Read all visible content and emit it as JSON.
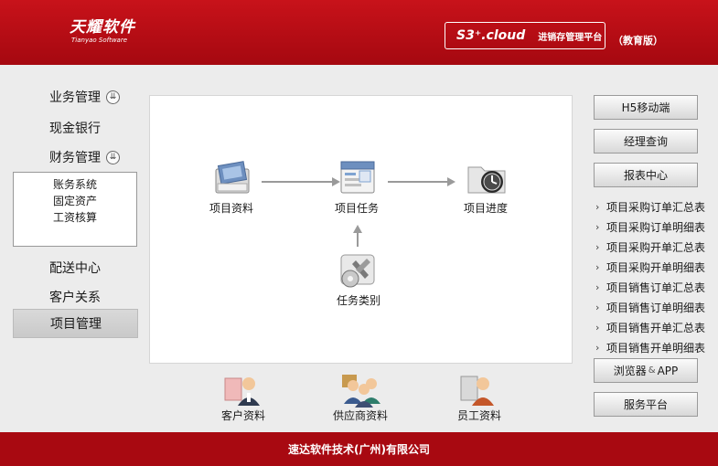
{
  "header": {
    "logo_cn": "天耀软件",
    "logo_en": "Tianyao Software",
    "product_name": "S3⁺.cloud",
    "product_desc": "进销存管理平台",
    "edition": "（教育版）"
  },
  "nav": {
    "business": "业务管理",
    "cash": "现金银行",
    "finance": "财务管理",
    "finance_sub": [
      "账务系统",
      "固定资产",
      "工资核算"
    ],
    "delivery": "配送中心",
    "customer": "客户关系",
    "project": "项目管理",
    "toggle_icon": "double-chevron-down"
  },
  "flow": {
    "project_data": "项目资料",
    "project_task": "项目任务",
    "project_progress": "项目进度",
    "task_category": "任务类别"
  },
  "bottom": {
    "customer_data": "客户资料",
    "supplier_data": "供应商资料",
    "employee_data": "员工资料"
  },
  "right": {
    "h5": "H5移动端",
    "manager_query": "经理查询",
    "report_center": "报表中心",
    "reports": [
      "项目采购订单汇总表",
      "项目采购订单明细表",
      "项目采购开单汇总表",
      "项目采购开单明细表",
      "项目销售订单汇总表",
      "项目销售订单明细表",
      "项目销售开单汇总表",
      "项目销售开单明细表"
    ],
    "browser": "浏览器",
    "amp": "&",
    "app": "APP",
    "service": "服务平台"
  },
  "footer": {
    "company": "速达软件技术(广州)有限公司"
  },
  "colors": {
    "brand_red": "#b80d15",
    "footer_red": "#a80911"
  }
}
